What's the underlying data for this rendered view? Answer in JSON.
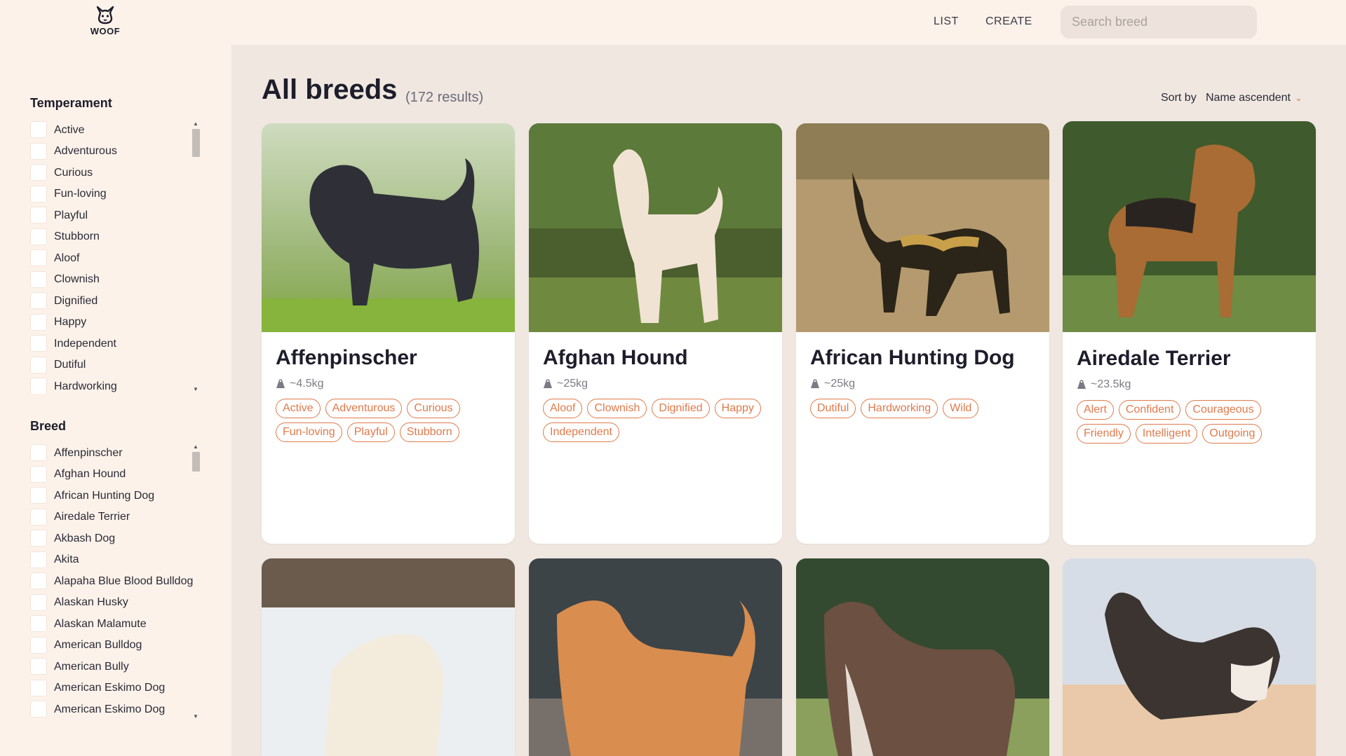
{
  "header": {
    "logo_text": "WOOF",
    "nav": {
      "list": "LIST",
      "create": "CREATE"
    },
    "search_placeholder": "Search breed"
  },
  "sidebar": {
    "temperament": {
      "title": "Temperament",
      "items": [
        "Active",
        "Adventurous",
        "Curious",
        "Fun-loving",
        "Playful",
        "Stubborn",
        "Aloof",
        "Clownish",
        "Dignified",
        "Happy",
        "Independent",
        "Dutiful",
        "Hardworking"
      ]
    },
    "breed": {
      "title": "Breed",
      "items": [
        "Affenpinscher",
        "Afghan Hound",
        "African Hunting Dog",
        "Airedale Terrier",
        "Akbash Dog",
        "Akita",
        "Alapaha Blue Blood Bulldog",
        "Alaskan Husky",
        "Alaskan Malamute",
        "American Bulldog",
        "American Bully",
        "American Eskimo Dog",
        "American Eskimo Dog"
      ]
    }
  },
  "main": {
    "title": "All breeds",
    "result_count": "(172 results)",
    "sort_label": "Sort by",
    "sort_value": "Name ascendent"
  },
  "cards": [
    {
      "name": "Affenpinscher",
      "weight": "~4.5kg",
      "tags": [
        "Active",
        "Adventurous",
        "Curious",
        "Fun-loving",
        "Playful",
        "Stubborn"
      ]
    },
    {
      "name": "Afghan Hound",
      "weight": "~25kg",
      "tags": [
        "Aloof",
        "Clownish",
        "Dignified",
        "Happy",
        "Independent"
      ]
    },
    {
      "name": "African Hunting Dog",
      "weight": "~25kg",
      "tags": [
        "Dutiful",
        "Hardworking",
        "Wild"
      ]
    },
    {
      "name": "Airedale Terrier",
      "weight": "~23.5kg",
      "tags": [
        "Alert",
        "Confident",
        "Courageous",
        "Friendly",
        "Intelligent",
        "Outgoing"
      ]
    }
  ],
  "colors": {
    "accent": "#e07a4c",
    "header_bg": "#fcf2ea",
    "main_bg": "#f0e7e1"
  }
}
